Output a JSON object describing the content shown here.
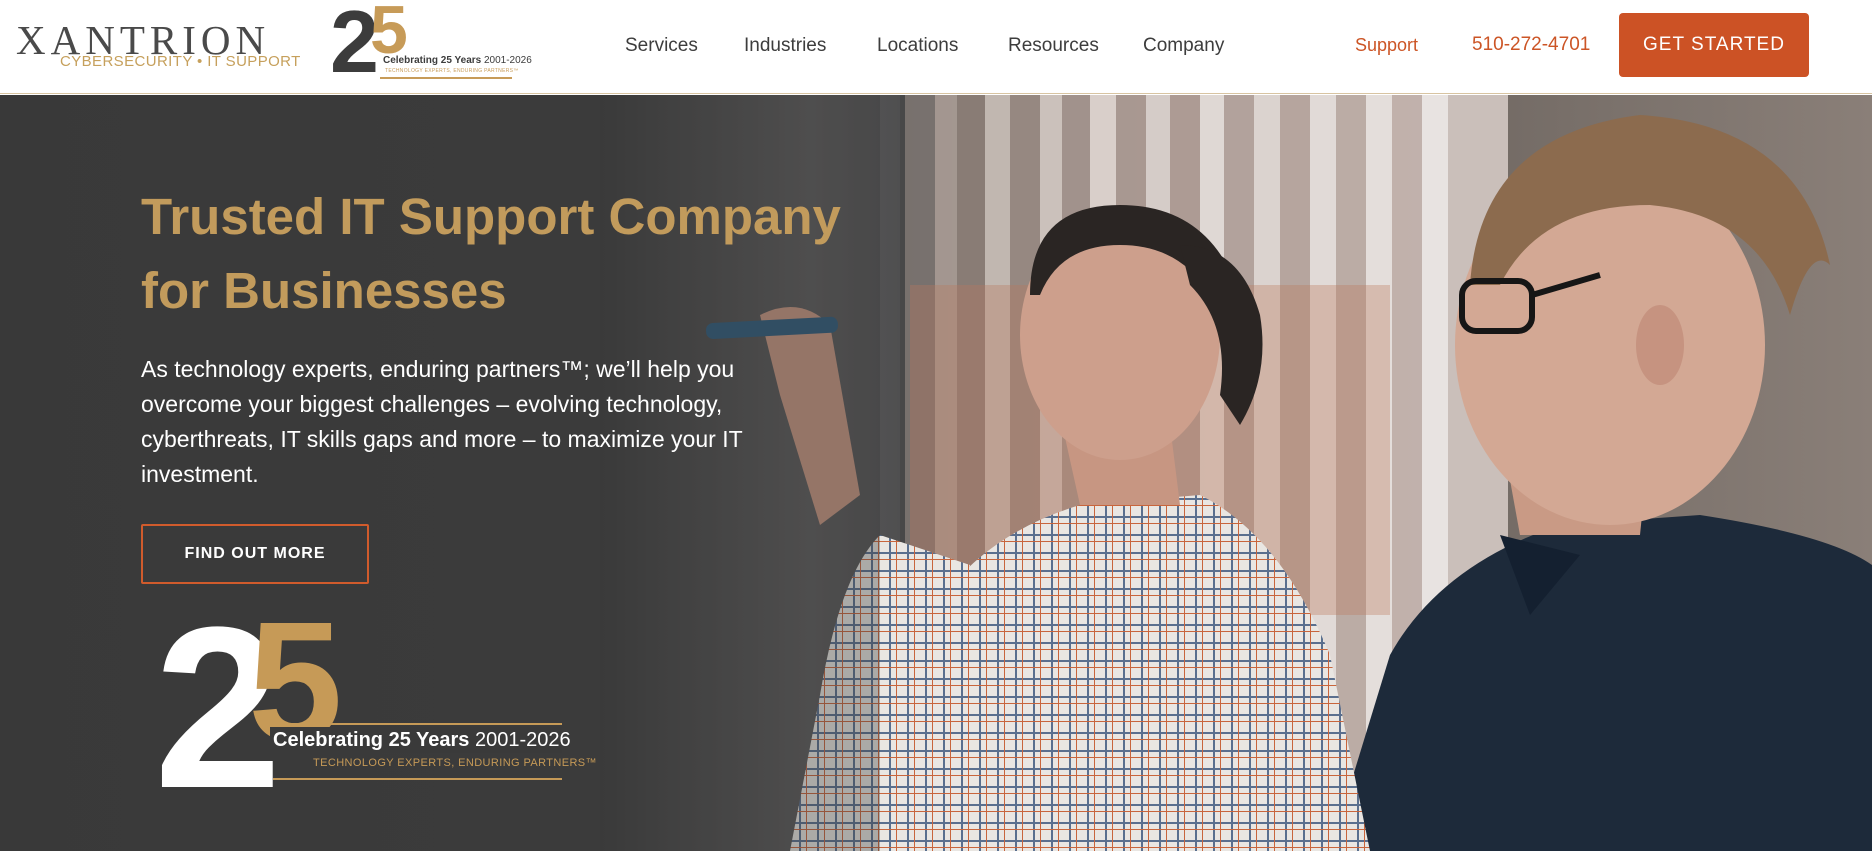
{
  "header": {
    "brand_name": "XANTRION",
    "brand_tagline": "CYBERSECURITY • IT SUPPORT",
    "anniversary": {
      "two": "2",
      "five": "5",
      "celebrating": "Celebrating 25 Years",
      "years": "2001-2026",
      "tagline": "TECHNOLOGY EXPERTS, ENDURING PARTNERS™"
    },
    "nav": [
      {
        "label": "Services"
      },
      {
        "label": "Industries"
      },
      {
        "label": "Locations"
      },
      {
        "label": "Resources"
      },
      {
        "label": "Company"
      }
    ],
    "support_label": "Support",
    "phone": "510-272-4701",
    "cta_label": "GET STARTED"
  },
  "hero": {
    "title": "Trusted IT Support Company for Businesses",
    "description": "As technology experts, enduring partners™; we’ll help you overcome your biggest challenges – evolving technology, cyberthreats, IT skills gaps and more – to maximize your IT investment.",
    "button_label": "FIND OUT MORE",
    "anniversary": {
      "two": "2",
      "five": "5",
      "celebrating": "Celebrating 25 Years",
      "years": "2001-2026",
      "tagline": "TECHNOLOGY EXPERTS, ENDURING PARTNERS™"
    }
  },
  "colors": {
    "accent_orange": "#cc5225",
    "gold": "#c29b5c",
    "dark_bg": "#3a3a3a",
    "nav_text": "#3d3d3d"
  }
}
